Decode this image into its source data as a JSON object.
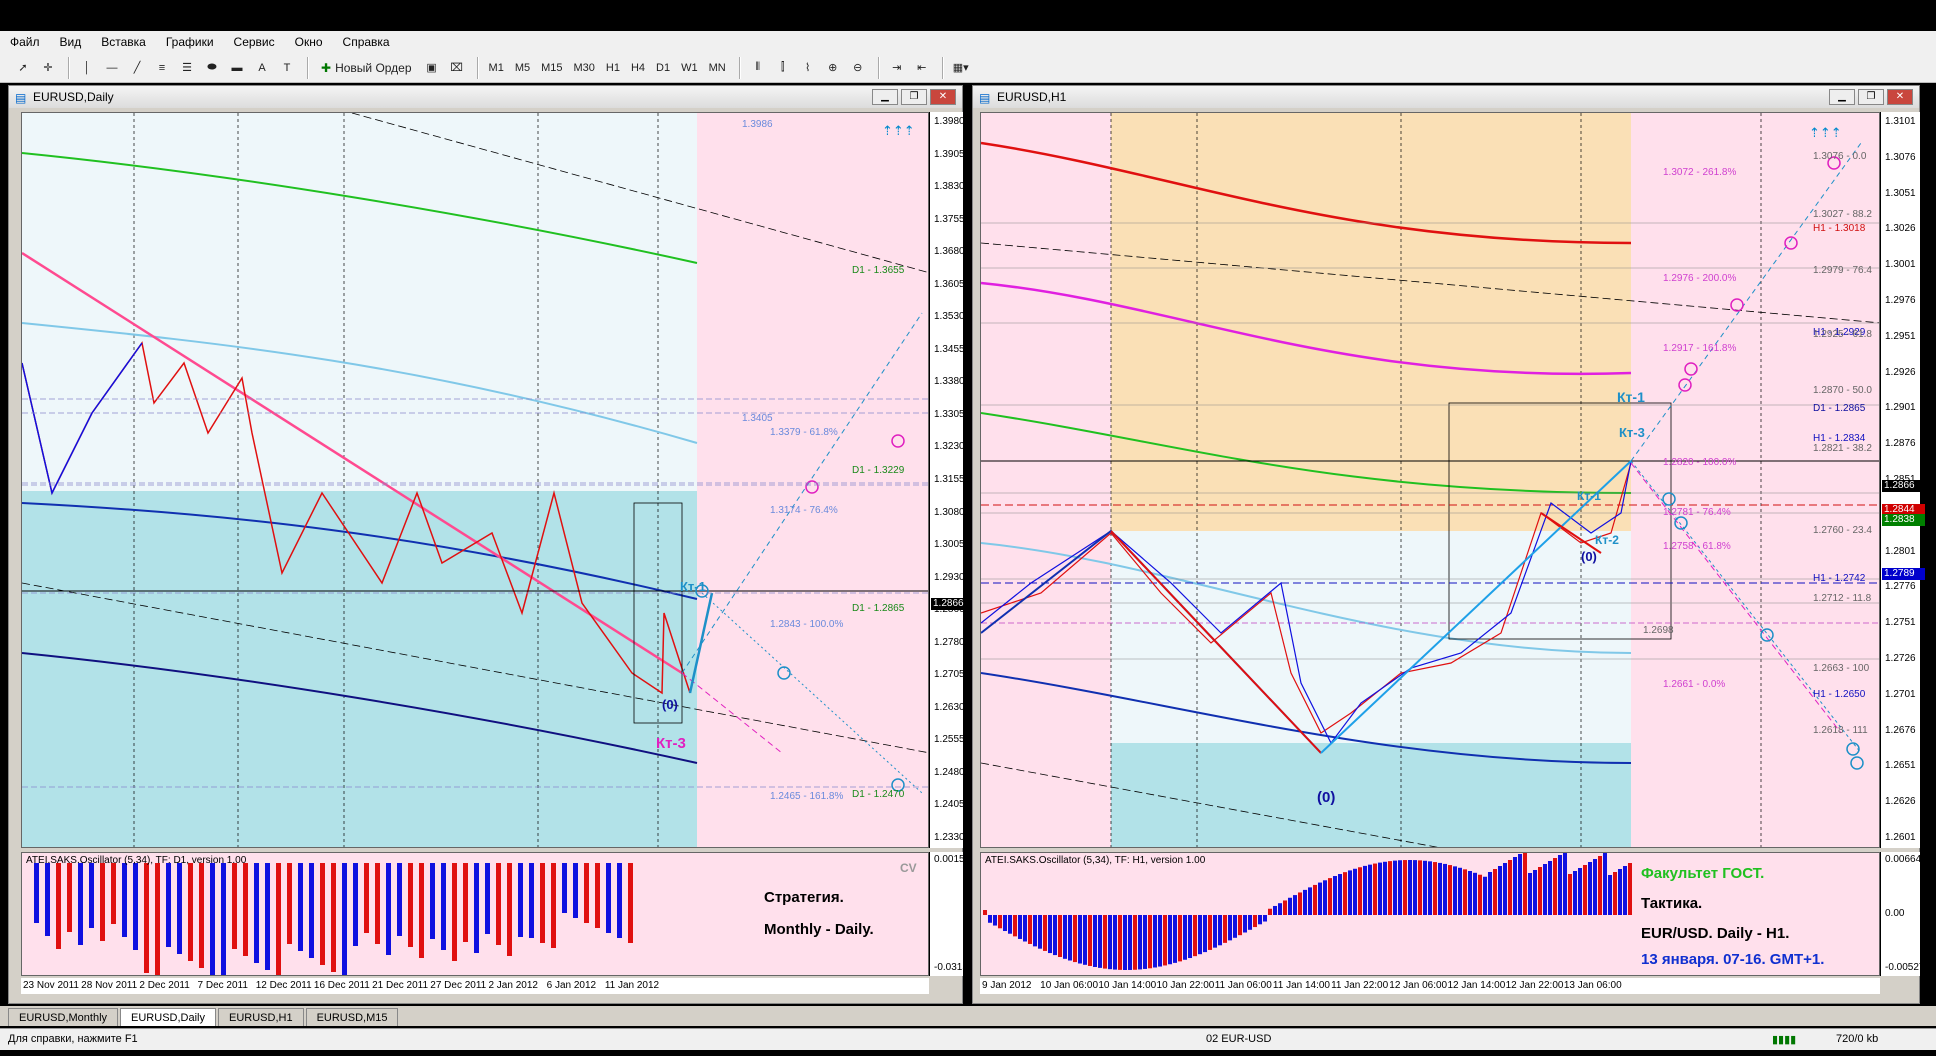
{
  "menu": [
    "Файл",
    "Вид",
    "Вставка",
    "Графики",
    "Сервис",
    "Окно",
    "Справка"
  ],
  "toolbar": {
    "new_order": "Новый Ордер",
    "timeframes": [
      "M1",
      "M5",
      "M15",
      "M30",
      "H1",
      "H4",
      "D1",
      "W1",
      "MN"
    ]
  },
  "left": {
    "title": "EURUSD,Daily",
    "yticks": [
      "1.3980",
      "1.3905",
      "1.3830",
      "1.3755",
      "1.3680",
      "1.3605",
      "1.3530",
      "1.3455",
      "1.3380",
      "1.3305",
      "1.3230",
      "1.3155",
      "1.3080",
      "1.3005",
      "1.2930",
      "1.2866",
      "1.2780",
      "1.2705",
      "1.2630",
      "1.2555",
      "1.2480",
      "1.2405",
      "1.2330"
    ],
    "current_price": "1.2866",
    "xlabels": [
      "23 Nov 2011",
      "28 Nov 2011",
      "2 Dec 2011",
      "7 Dec 2011",
      "12 Dec 2011",
      "16 Dec 2011",
      "21 Dec 2011",
      "27 Dec 2011",
      "2 Jan 2012",
      "6 Jan 2012",
      "11 Jan 2012"
    ],
    "annotations": [
      "1.3986",
      "D1 - 1.3655",
      "1.3405",
      "1.3379 - 61.8%",
      "D1 - 1.3229",
      "1.3174 - 76.4%",
      "D1 - 1.2865",
      "1.2843 - 100.0%",
      "1.2465 - 161.8%",
      "D1 - 1.2470"
    ],
    "labels": {
      "kt1": "Кт-1",
      "kt3": "Кт-3",
      "zero": "(0)"
    },
    "osc_title": "ATEI.SAKS.Oscillator (5,34), TF: D1, version 1.00",
    "osc_top": "0.0015",
    "osc_bottom": "-0.03158",
    "cv": "CV",
    "text1": "Стратегия.",
    "text2": "Monthly - Daily."
  },
  "right": {
    "title": "EURUSD,H1",
    "yticks": [
      "1.3101",
      "1.3076",
      "1.3051",
      "1.3026",
      "1.3001",
      "1.2976",
      "1.2951",
      "1.2926",
      "1.2901",
      "1.2876",
      "1.2851",
      "1.2826",
      "1.2801",
      "1.2776",
      "1.2751",
      "1.2726",
      "1.2701",
      "1.2676",
      "1.2651",
      "1.2626",
      "1.2601"
    ],
    "price_boxes": [
      {
        "v": "1.2866",
        "c": "#000000"
      },
      {
        "v": "1.2844",
        "c": "#d00000"
      },
      {
        "v": "1.2838",
        "c": "#008000"
      },
      {
        "v": "1.2789",
        "c": "#0000cc"
      }
    ],
    "xlabels": [
      "9 Jan 2012",
      "10 Jan 06:00",
      "10 Jan 14:00",
      "10 Jan 22:00",
      "11 Jan 06:00",
      "11 Jan 14:00",
      "11 Jan 22:00",
      "12 Jan 06:00",
      "12 Jan 14:00",
      "12 Jan 22:00",
      "13 Jan 06:00"
    ],
    "annotations": [
      "1.3076 - 0.0",
      "1.3072 - 261.8%",
      "1.3027 - 88.2",
      "H1 - 1.3018",
      "1.2979 - 76.4",
      "1.2976 - 200.0%",
      "H1 - 1.2929",
      "1.2925 - 61.8",
      "1.2917 - 161.8%",
      "1.2870 - 50.0",
      "D1 - 1.2865",
      "H1 - 1.2834",
      "1.2821 - 38.2",
      "1.2820 - 100.0%",
      "1.2781 - 76.4%",
      "1.2760 - 23.4",
      "1.2758 - 61.8%",
      "H1 - 1.2742",
      "1.2712 - 11.8",
      "1.2698",
      "1.2663 - 100",
      "1.2661 - 0.0%",
      "H1 - 1.2650",
      "1.2618 - 111"
    ],
    "labels": {
      "kt1": "Кт-1",
      "kt3": "Кт-3",
      "kt1b": "Кт-1",
      "kt2": "Кт-2",
      "zero_a": "(0)",
      "zero_b": "(0)"
    },
    "osc_title": "ATEI.SAKS.Oscillator (5,34), TF: H1, version 1.00",
    "osc_top": "0.00664",
    "osc_mid": "0.00",
    "osc_bottom": "-0.00527",
    "text1": "Факультет ГОСТ.",
    "text2": "Тактика.",
    "text3": "EUR/USD. Daily - H1.",
    "text4": "13 января. 07-16. GMT+1."
  },
  "tabs": [
    "EURUSD,Monthly",
    "EURUSD,Daily",
    "EURUSD,H1",
    "EURUSD,M15"
  ],
  "active_tab": 1,
  "status": {
    "help": "Для справки, нажмите F1",
    "profile": "02 EUR-USD",
    "traffic": "720/0 kb"
  },
  "colors": {
    "pink": "#ffe0ec",
    "teal": "#b2e2e8",
    "lightblue": "#eef7fa",
    "orange": "#fae0b6",
    "red": "#e01010",
    "blue": "#1010e0",
    "green": "#20c020",
    "navy": "#101080"
  }
}
